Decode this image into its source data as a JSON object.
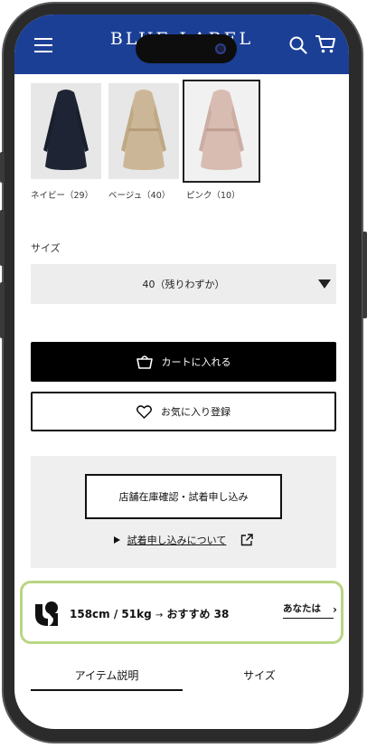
{
  "header": {
    "brand": "BLUE LABEL",
    "menu_icon": "hamburger-menu-icon",
    "search_icon": "search-icon",
    "cart_icon": "shopping-cart-icon",
    "color": "#1c3f96"
  },
  "swatches": [
    {
      "label": "ネイビー（29）",
      "color": "#1e2433",
      "selected": false
    },
    {
      "label": "ベージュ（40）",
      "color": "#cbb797",
      "selected": false
    },
    {
      "label": "ピンク（10）",
      "color": "#d8bcb1",
      "selected": true
    }
  ],
  "size": {
    "label": "サイズ",
    "selected": "40（残りわずか）"
  },
  "actions": {
    "cart_label": "カートに入れる",
    "favorite_label": "お気に入り登録"
  },
  "store": {
    "button_label": "店舗在庫確認・試着申し込み",
    "link_label": "試着申し込みについて"
  },
  "fit": {
    "body": "158cm / 51kg",
    "arrow": "→",
    "recommend": "おすすめ 38",
    "you_label": "あなたは",
    "accent": "#b9d583"
  },
  "tabs": [
    {
      "label": "アイテム説明",
      "active": true
    },
    {
      "label": "サイズ",
      "active": false
    }
  ]
}
